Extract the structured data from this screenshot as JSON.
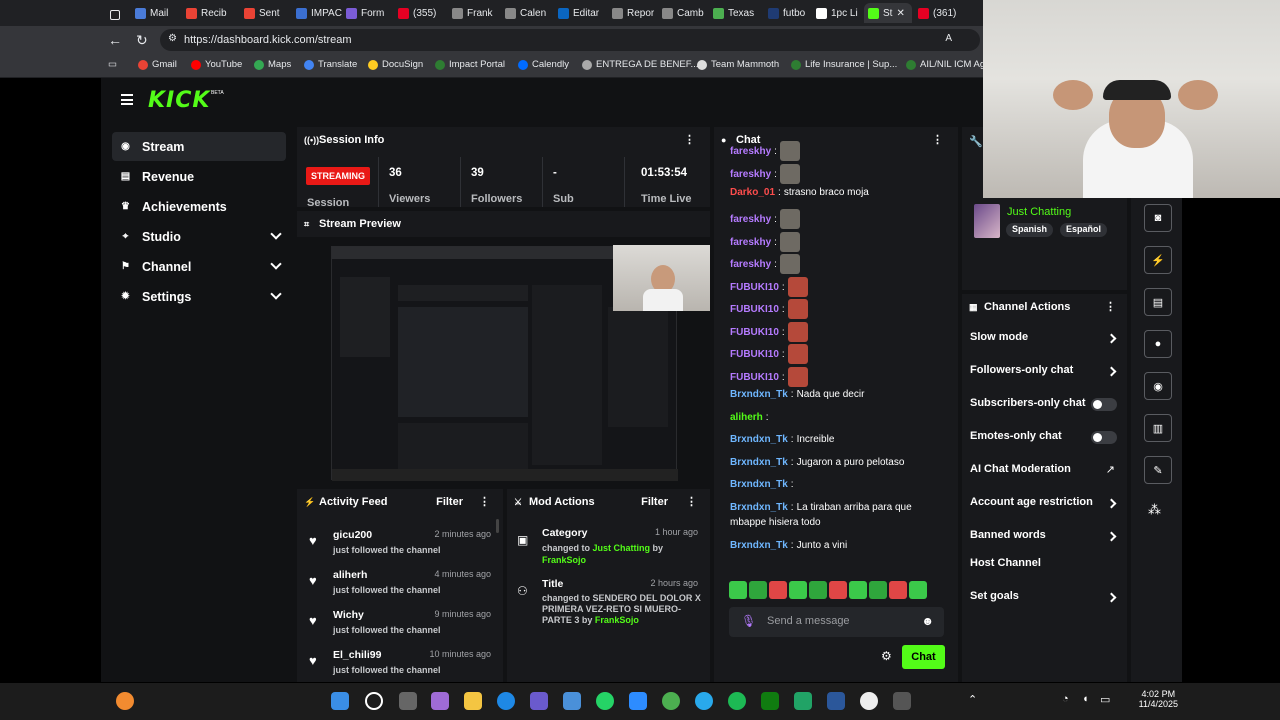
{
  "browser": {
    "tabs": [
      "Mail",
      "Recib",
      "Sent",
      "IMPAC",
      "Form",
      "(355)",
      "Frank",
      "Calen",
      "Editar",
      "Repor",
      "Camb",
      "Texas",
      "futbo",
      "1pc Li",
      "St",
      "(361)"
    ],
    "url": "https://dashboard.kick.com/stream",
    "bookmarks": [
      "Gmail",
      "YouTube",
      "Maps",
      "Translate",
      "DocuSign",
      "Impact Portal",
      "Calendly",
      "ENTREGA DE BENEF...",
      "Team Mammoth",
      "Life Insurance | Sup...",
      "AIL/NIL ICM Ag"
    ]
  },
  "app": {
    "logo": "KICK",
    "beta": "BETA"
  },
  "sidebar": {
    "items": [
      {
        "label": "Stream",
        "icon": "stream-icon"
      },
      {
        "label": "Revenue",
        "icon": "revenue-icon"
      },
      {
        "label": "Achievements",
        "icon": "trophy-icon"
      },
      {
        "label": "Studio",
        "icon": "studio-icon"
      },
      {
        "label": "Channel",
        "icon": "channel-icon"
      },
      {
        "label": "Settings",
        "icon": "gear-icon"
      }
    ]
  },
  "session": {
    "title": "Session Info",
    "badge": "STREAMING",
    "stats": [
      {
        "value": "",
        "label": "Session"
      },
      {
        "value": "36",
        "label": "Viewers"
      },
      {
        "value": "39",
        "label": "Followers"
      },
      {
        "value": "-",
        "label": "Sub"
      },
      {
        "value": "01:53:54",
        "label": "Time Live"
      }
    ]
  },
  "preview": {
    "title": "Stream Preview"
  },
  "activity": {
    "title": "Activity Feed",
    "filter": "Filter",
    "items": [
      {
        "name": "gicu200",
        "time": "2 minutes ago",
        "desc": "just followed the channel"
      },
      {
        "name": "aliherh",
        "time": "4 minutes ago",
        "desc": "just followed the channel"
      },
      {
        "name": "Wichy",
        "time": "9 minutes ago",
        "desc": "just followed the channel"
      },
      {
        "name": "El_chili99",
        "time": "10 minutes ago",
        "desc": "just followed the channel"
      }
    ]
  },
  "mod": {
    "title": "Mod Actions",
    "filter": "Filter",
    "items": [
      {
        "title": "Category",
        "time": "1 hour ago",
        "pre": "changed to ",
        "value": "Just Chatting",
        "by": " by ",
        "user": "FrankSojo"
      },
      {
        "title": "Title",
        "time": "2 hours ago",
        "pre": "changed to ",
        "value": "SENDERO DEL DOLOR X PRIMERA VEZ-RETO SI MUERO-PARTE 3",
        "by": " by ",
        "user": "FrankSojo"
      }
    ]
  },
  "chat": {
    "title": "Chat",
    "messages": [
      {
        "user": "fareskhy",
        "text": "",
        "color": "#b57bff",
        "emote": true
      },
      {
        "user": "fareskhy",
        "text": "",
        "color": "#b57bff",
        "emote": true
      },
      {
        "user": "Darko_01",
        "text": "strasno braco moja",
        "color": "#ff4d4d",
        "emote": false
      },
      {
        "user": "fareskhy",
        "text": "",
        "color": "#b57bff",
        "emote": true
      },
      {
        "user": "fareskhy",
        "text": "",
        "color": "#b57bff",
        "emote": true
      },
      {
        "user": "fareskhy",
        "text": "",
        "color": "#b57bff",
        "emote": true
      },
      {
        "user": "FUBUKI10",
        "text": "",
        "color": "#b57bff",
        "emote": true
      },
      {
        "user": "FUBUKI10",
        "text": "",
        "color": "#b57bff",
        "emote": true
      },
      {
        "user": "FUBUKI10",
        "text": "",
        "color": "#b57bff",
        "emote": true
      },
      {
        "user": "FUBUKI10",
        "text": "",
        "color": "#b57bff",
        "emote": true
      },
      {
        "user": "FUBUKI10",
        "text": "",
        "color": "#b57bff",
        "emote": true
      },
      {
        "user": "Brxndxn_Tk",
        "text": "Nada que decir",
        "color": "#6fb7ff",
        "emote": false
      },
      {
        "user": "aliherh",
        "text": "",
        "color": "#53fc18",
        "emote": false
      },
      {
        "user": "Brxndxn_Tk",
        "text": "Increible",
        "color": "#6fb7ff",
        "emote": false
      },
      {
        "user": "Brxndxn_Tk",
        "text": "Jugaron a puro pelotaso",
        "color": "#6fb7ff",
        "emote": false
      },
      {
        "user": "Brxndxn_Tk",
        "text": "",
        "color": "#6fb7ff",
        "emote": false
      },
      {
        "user": "Brxndxn_Tk",
        "text": "La tiraban arriba para que",
        "color": "#6fb7ff",
        "emote": false
      },
      {
        "user": "",
        "text": "mbappe hisiera todo",
        "color": "#6fb7ff",
        "emote": false
      },
      {
        "user": "Brxndxn_Tk",
        "text": "Junto a vini",
        "color": "#6fb7ff",
        "emote": false
      }
    ],
    "placeholder": "Send a message",
    "send": "Chat"
  },
  "channel": {
    "category": "Just Chatting",
    "tags": [
      "Spanish",
      "Español"
    ]
  },
  "actions": {
    "title": "Channel Actions",
    "items": [
      {
        "label": "Slow mode",
        "kind": "arrow"
      },
      {
        "label": "Followers-only chat",
        "kind": "arrow"
      },
      {
        "label": "Subscribers-only chat",
        "kind": "toggle"
      },
      {
        "label": "Emotes-only chat",
        "kind": "toggle"
      },
      {
        "label": "AI Chat Moderation",
        "kind": "external"
      },
      {
        "label": "Account age restriction",
        "kind": "arrow"
      },
      {
        "label": "Banned words",
        "kind": "arrow"
      },
      {
        "label": "Host Channel",
        "kind": "none"
      },
      {
        "label": "Set goals",
        "kind": "arrow"
      }
    ]
  },
  "taskbar": {
    "time": "4:02 PM",
    "date": "11/4/2025"
  }
}
